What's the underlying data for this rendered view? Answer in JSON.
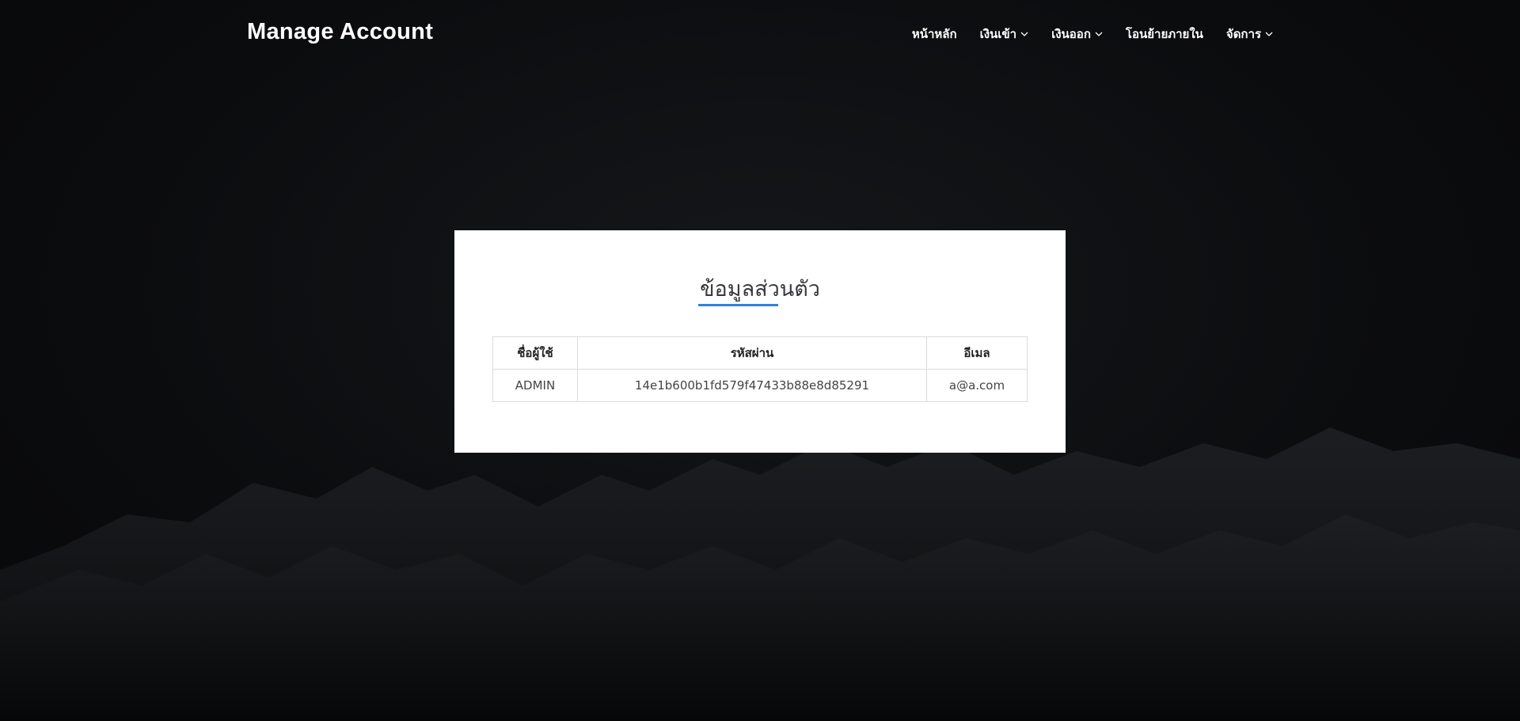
{
  "header": {
    "brand": "Manage Account",
    "nav": [
      {
        "label": "หน้าหลัก",
        "icon": ""
      },
      {
        "label": "เงินเข้า",
        "icon": "chevron-down-icon"
      },
      {
        "label": "เงินออก",
        "icon": "chevron-down-icon"
      },
      {
        "label": "โอนย้ายภายใน",
        "icon": ""
      },
      {
        "label": "จัดการ",
        "icon": "chevron-down-icon"
      }
    ]
  },
  "card": {
    "title": "ข้อมูลส่วนตัว",
    "accent_color": "#2f82e0",
    "table": {
      "headers": [
        "ชื่อผู้ใช้",
        "รหัสผ่าน",
        "อีเมล"
      ],
      "rows": [
        [
          "ADMIN",
          "14e1b600b1fd579f47433b88e8d85291",
          "a@a.com"
        ]
      ]
    }
  },
  "background": {
    "description_icon": "mountain-background-image"
  }
}
